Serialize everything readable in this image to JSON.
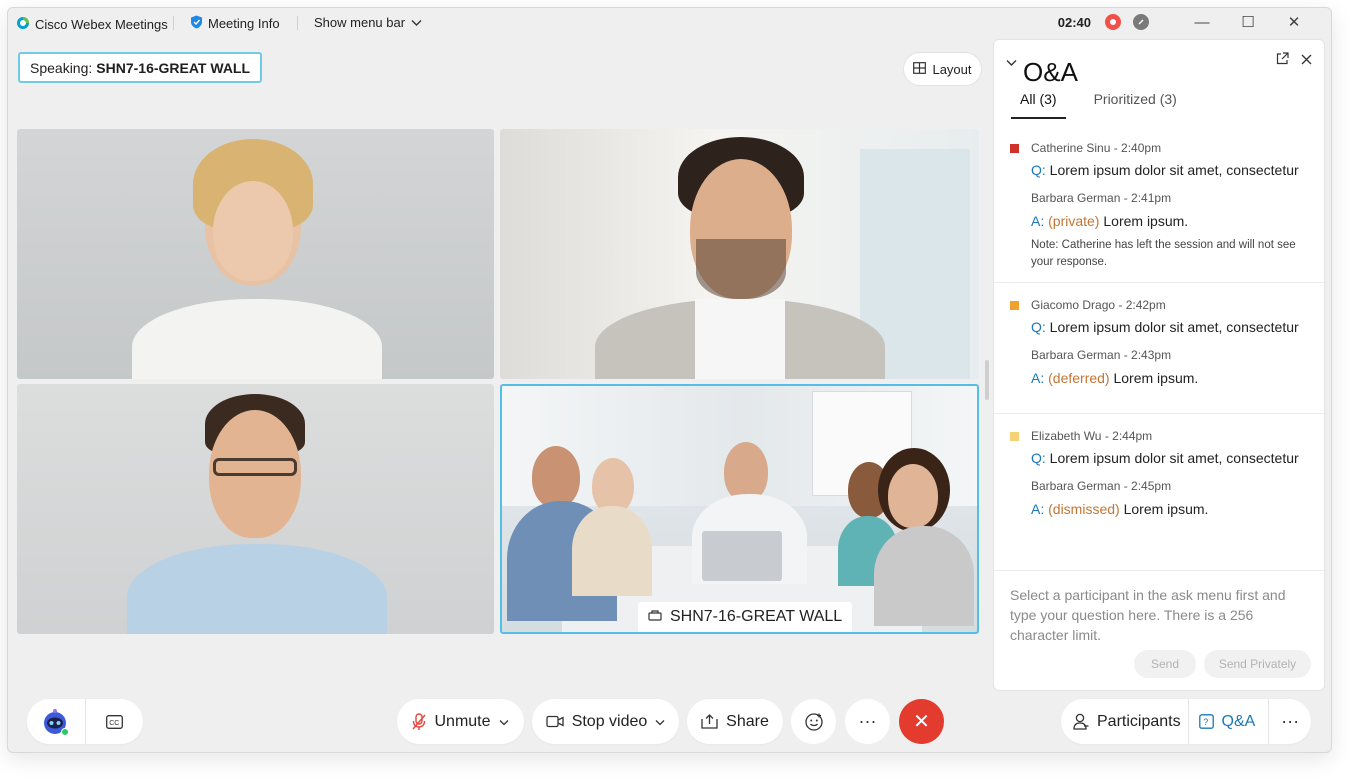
{
  "titlebar": {
    "app_name": "Cisco Webex Meetings",
    "meeting_info": "Meeting Info",
    "show_menu_bar": "Show menu bar",
    "clock": "02:40",
    "minimize": "—",
    "maximize": "☐",
    "close": "✕"
  },
  "stage": {
    "speaking_prefix": "Speaking:",
    "speaking_name": "SHN7-16-GREAT WALL",
    "layout_label": "Layout",
    "room_label": "SHN7-16-GREAT WALL"
  },
  "qa": {
    "title": "O&A",
    "tabs": [
      {
        "label": "All (3)",
        "active": true
      },
      {
        "label": "Prioritized (3)",
        "active": false
      }
    ],
    "items": [
      {
        "asker": "Catherine Sinu - 2:40pm",
        "color": "#d0322a",
        "q_label": "Q:",
        "question": "Lorem ipsum dolor sit amet, consectetur",
        "responder": "Barbara German - 2:41pm",
        "a_label": "A:",
        "status": "(private)",
        "answer": "Lorem ipsum.",
        "note": "Note: Catherine has left the session and will not see your response."
      },
      {
        "asker": "Giacomo Drago - 2:42pm",
        "color": "#f2a12c",
        "q_label": "Q:",
        "question": "Lorem ipsum dolor sit amet, consectetur",
        "responder": "Barbara German - 2:43pm",
        "a_label": "A:",
        "status": "(deferred)",
        "answer": "Lorem ipsum."
      },
      {
        "asker": "Elizabeth Wu - 2:44pm",
        "color": "#f6d276",
        "q_label": "Q:",
        "question": "Lorem ipsum dolor sit amet, consectetur",
        "responder": "Barbara German - 2:45pm",
        "a_label": "A:",
        "status": "(dismissed)",
        "answer": "Lorem ipsum."
      }
    ],
    "input_placeholder": "Select a participant in the ask menu first and type your question here. There is a 256 character limit.",
    "send_label": "Send",
    "send_privately_label": "Send Privately"
  },
  "controls": {
    "unmute": "Unmute",
    "stop_video": "Stop video",
    "share": "Share",
    "more": "···",
    "end": "✕",
    "participants": "Participants",
    "qa": "Q&A",
    "right_more": "···"
  }
}
